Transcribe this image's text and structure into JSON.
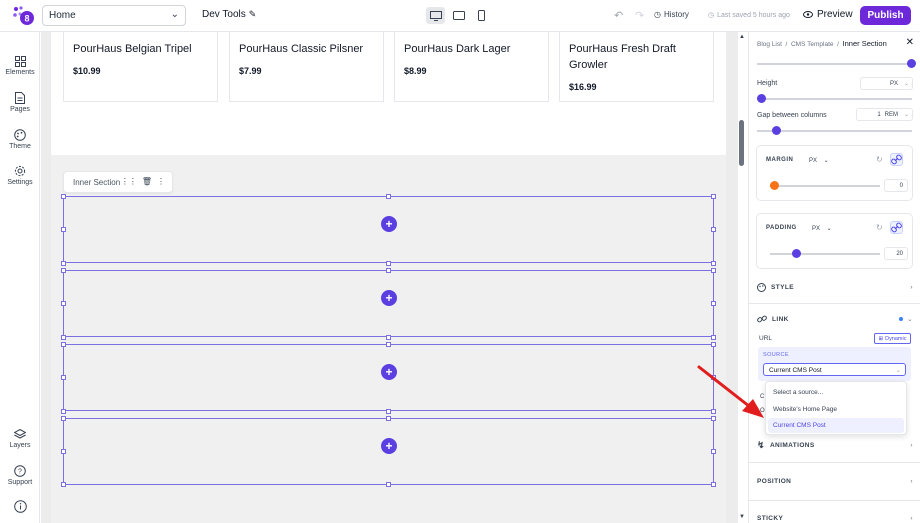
{
  "topbar": {
    "page_name": "Home",
    "title": "Dev Tools",
    "history_label": "History",
    "saved_text": "Last saved 5 hours ago",
    "preview_label": "Preview",
    "publish_label": "Publish"
  },
  "rail": {
    "items": [
      {
        "label": "Elements",
        "icon": "grid-icon"
      },
      {
        "label": "Pages",
        "icon": "page-icon"
      },
      {
        "label": "Theme",
        "icon": "palette-icon"
      },
      {
        "label": "Settings",
        "icon": "gear-icon"
      },
      {
        "label": "Layers",
        "icon": "layers-icon"
      },
      {
        "label": "Support",
        "icon": "help-icon"
      }
    ]
  },
  "products": [
    {
      "name": "PourHaus Belgian Tripel",
      "price": "$10.99"
    },
    {
      "name": "PourHaus Classic Pilsner",
      "price": "$7.99"
    },
    {
      "name": "PourHaus Dark Lager",
      "price": "$8.99"
    },
    {
      "name": "PourHaus Fresh Draft Growler",
      "price": "$16.99"
    }
  ],
  "canvas": {
    "selected_label": "Inner Section",
    "add_symbol": "+"
  },
  "panel": {
    "breadcrumb": [
      "Blog List",
      "CMS Template",
      "Inner Section"
    ],
    "height_label": "Height",
    "height_unit": "PX",
    "gap_label": "Gap between columns",
    "gap_value": "1",
    "gap_unit": "REM",
    "margin_label": "MARGIN",
    "margin_unit": "PX",
    "margin_value": "0",
    "padding_label": "PADDING",
    "padding_unit": "PX",
    "padding_value": "20",
    "style_label": "STYLE",
    "link_label": "LINK",
    "url_label": "URL",
    "dynamic_label": "Dynamic",
    "source_label": "SOURCE",
    "source_value": "Current CMS Post",
    "source_options": [
      "Select a source...",
      "Website's Home Page",
      "Current CMS Post"
    ],
    "animations_label": "ANIMATIONS",
    "position_label": "POSITION",
    "sticky_label": "STICKY"
  },
  "colors": {
    "accent": "#6d28d9",
    "selection": "#7c6fe0",
    "margin_knob": "#f97316",
    "arrow": "#e11d1d"
  }
}
